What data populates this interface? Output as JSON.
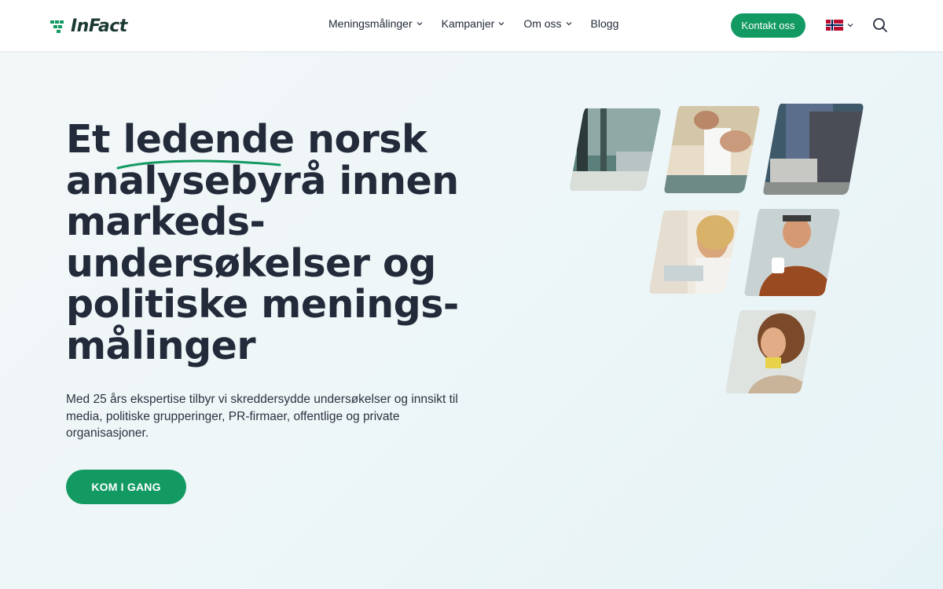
{
  "brand": {
    "name": "InFact",
    "color": "#139a63"
  },
  "nav": {
    "items": [
      {
        "label": "Meningsmålinger",
        "has_dropdown": true
      },
      {
        "label": "Kampanjer",
        "has_dropdown": true
      },
      {
        "label": "Om oss",
        "has_dropdown": true
      },
      {
        "label": "Blogg",
        "has_dropdown": false
      }
    ],
    "contact_label": "Kontakt oss",
    "language_icon": "norway-flag-icon",
    "search_icon": "search-icon"
  },
  "hero": {
    "headline_part1": "Et",
    "headline_highlight": "ledende",
    "headline_part2": "norsk analysebyrå innen markeds-undersøkelser og politiske menings-målinger",
    "lead": "Med 25 års ekspertise tilbyr vi skreddersydde undersøkelser og innsikt til media, politiske grupperinger, PR-firmaer, offentlige og private organisasjoner.",
    "cta_label": "KOM I GANG"
  },
  "colors": {
    "text": "#232a3a",
    "accent": "#139a63",
    "header_bg": "#ffffff"
  }
}
